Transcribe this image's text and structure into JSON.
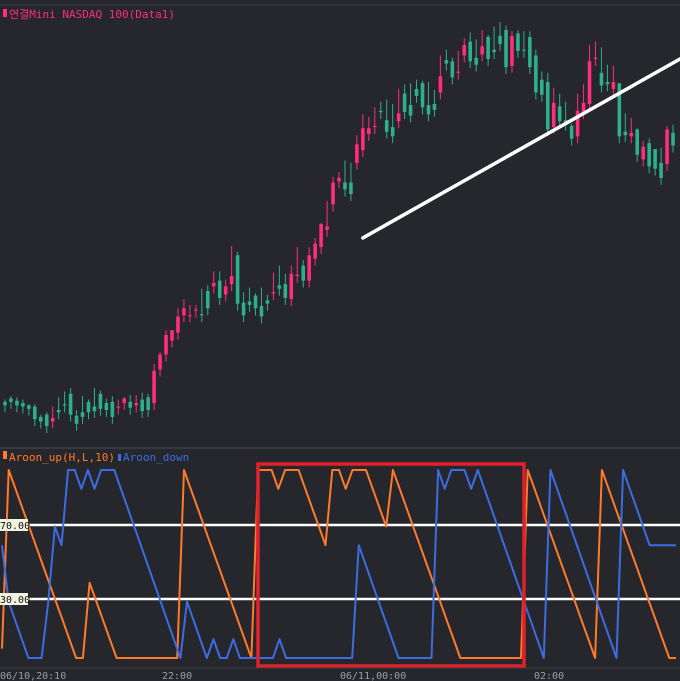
{
  "price_pane": {
    "title": "연결Mini NASDAQ 100(Data1)",
    "title_color": "#ff2d7a",
    "marker_color": "#ff2d7a"
  },
  "indicator_pane": {
    "up_label": "Aroon_up(H,L,10)",
    "down_label": "Aroon_down",
    "up_color": "#ff7a2a",
    "down_color": "#3d6be0",
    "level_high": "70.00",
    "level_low": "30.00"
  },
  "time_axis": {
    "labels": [
      "06/10,20:10",
      "22:00",
      "06/11,00:00",
      "02:00"
    ]
  },
  "colors": {
    "background": "#25272c",
    "up_candle": "#ff2d7a",
    "down_candle": "#2fb08a",
    "trendline": "#ffffff",
    "highlight_box": "#e0202a",
    "level_line": "#ffffff"
  },
  "chart_data": [
    {
      "type": "candlestick",
      "title": "연결Mini NASDAQ 100(Data1)",
      "ohlc": [
        [
          300,
          297,
          302,
          303
        ],
        [
          303,
          300,
          305,
          301
        ],
        [
          301,
          297,
          304,
          299
        ],
        [
          299,
          296,
          302,
          297
        ],
        [
          297,
          294,
          298,
          296
        ],
        [
          296,
          285,
          298,
          287
        ],
        [
          287,
          283,
          289,
          289
        ],
        [
          289,
          279,
          291,
          283
        ],
        [
          283,
          286,
          296,
          293
        ],
        [
          293,
          291,
          304,
          298
        ],
        [
          298,
          297,
          309,
          307
        ],
        [
          307,
          289,
          312,
          288
        ],
        [
          288,
          281,
          293,
          291
        ],
        [
          291,
          287,
          305,
          300
        ],
        [
          300,
          291,
          302,
          296
        ],
        [
          296,
          292,
          312,
          307
        ],
        [
          307,
          294,
          310,
          299
        ],
        [
          299,
          293,
          303,
          300
        ],
        [
          300,
          287,
          305,
          295
        ],
        [
          295,
          296,
          302,
          299
        ],
        [
          299,
          303,
          304,
          300
        ],
        [
          300,
          295,
          306,
          297
        ],
        [
          297,
          299,
          306,
          302
        ],
        [
          302,
          292,
          308,
          304
        ],
        [
          304,
          293,
          307,
          299
        ],
        [
          299,
          327,
          333,
          328
        ],
        [
          328,
          341,
          343,
          341
        ],
        [
          341,
          358,
          362,
          353
        ],
        [
          353,
          362,
          362,
          360
        ],
        [
          360,
          374,
          381,
          375
        ],
        [
          375,
          381,
          389,
          375
        ],
        [
          375,
          375,
          384,
          379
        ],
        [
          379,
          380,
          384,
          376
        ],
        [
          376,
          375,
          398,
          396
        ],
        [
          396,
          381,
          401,
          400
        ],
        [
          400,
          403,
          413,
          405
        ],
        [
          405,
          390,
          413,
          393
        ],
        [
          393,
          400,
          406,
          402
        ],
        [
          402,
          409,
          435,
          427
        ],
        [
          427,
          385,
          430,
          386
        ],
        [
          386,
          375,
          395,
          387
        ],
        [
          387,
          384,
          399,
          392
        ],
        [
          392,
          381,
          394,
          383
        ],
        [
          383,
          374,
          399,
          388
        ],
        [
          388,
          385,
          393,
          394
        ],
        [
          394,
          395,
          412,
          401
        ],
        [
          401,
          398,
          418,
          402
        ],
        [
          402,
          390,
          411,
          389
        ],
        [
          389,
          411,
          418,
          409
        ],
        [
          409,
          410,
          434,
          418
        ],
        [
          418,
          405,
          423,
          405
        ],
        [
          405,
          427,
          434,
          424
        ],
        [
          424,
          437,
          442,
          434
        ],
        [
          434,
          454,
          455,
          449
        ],
        [
          449,
          452,
          474,
          471
        ],
        [
          471,
          490,
          495,
          491
        ],
        [
          491,
          494,
          499,
          490
        ],
        [
          490,
          484,
          509,
          490
        ],
        [
          490,
          480,
          507,
          507
        ],
        [
          507,
          523,
          531,
          518
        ],
        [
          518,
          537,
          549,
          532
        ],
        [
          532,
          537,
          547,
          538
        ],
        [
          538,
          539,
          555,
          552
        ],
        [
          552,
          551,
          560,
          544
        ],
        [
          544,
          534,
          562,
          538
        ],
        [
          538,
          530,
          558,
          543
        ],
        [
          543,
          550,
          571,
          567
        ],
        [
          567,
          551,
          575,
          557
        ],
        [
          557,
          548,
          576,
          571
        ],
        [
          571,
          565,
          579,
          576
        ],
        [
          576,
          555,
          578,
          557
        ],
        [
          557,
          549,
          577,
          558
        ],
        [
          558,
          553,
          570,
          568
        ],
        [
          568,
          582,
          600,
          596
        ],
        [
          596,
          593,
          605,
          595
        ],
        [
          595,
          581,
          598,
          585
        ],
        [
          585,
          586,
          604,
          600
        ],
        [
          600,
          609,
          615,
          612
        ],
        [
          612,
          595,
          620,
          598
        ],
        [
          598,
          592,
          614,
          601
        ],
        [
          601,
          608,
          622,
          616
        ],
        [
          616,
          597,
          618,
          605
        ],
        [
          605,
          603,
          625,
          617
        ],
        [
          617,
          610,
          629,
          622
        ],
        [
          622,
          590,
          626,
          591
        ],
        [
          591,
          617,
          621,
          619
        ],
        [
          619,
          604,
          622,
          605
        ],
        [
          605,
          604,
          621,
          616
        ],
        [
          616,
          590,
          621,
          600
        ],
        [
          600,
          568,
          605,
          579
        ],
        [
          579,
          566,
          586,
          577
        ],
        [
          577,
          536,
          585,
          538
        ],
        [
          538,
          559,
          572,
          556
        ],
        [
          556,
          543,
          567,
          544
        ],
        [
          544,
          541,
          560,
          539
        ],
        [
          539,
          528,
          541,
          530
        ],
        [
          530,
          552,
          567,
          551
        ],
        [
          551,
          559,
          575,
          558
        ],
        [
          558,
          595,
          609,
          597
        ],
        [
          597,
          598,
          612,
          585
        ],
        [
          585,
          574,
          607,
          577
        ],
        [
          577,
          575,
          592,
          571
        ],
        [
          571,
          577,
          591,
          576
        ],
        [
          576,
          530,
          575,
          534
        ],
        [
          534,
          531,
          550,
          530
        ],
        [
          530,
          533,
          546,
          536
        ],
        [
          536,
          514,
          537,
          510
        ],
        [
          510,
          521,
          526,
          524
        ],
        [
          524,
          504,
          528,
          519
        ],
        [
          519,
          502,
          518,
          507
        ],
        [
          507,
          494,
          520,
          506
        ],
        [
          506,
          536,
          539,
          533
        ],
        [
          533,
          522,
          540,
          525
        ]
      ],
      "trendline": {
        "from": {
          "index": 60,
          "value": 442
        },
        "to": {
          "index": 118,
          "value": 611
        }
      }
    },
    {
      "type": "line",
      "title": "",
      "ylim": [
        0,
        100
      ],
      "levels": [
        70,
        30
      ],
      "series": [
        {
          "name": "Aroon_up(H,L,10)",
          "color": "#ff7a2a",
          "values": [
            5,
            100,
            90,
            80,
            70,
            60,
            50,
            40,
            30,
            20,
            10,
            0,
            0,
            40,
            30,
            20,
            10,
            0,
            0,
            0,
            0,
            0,
            0,
            0,
            0,
            0,
            0,
            100,
            90,
            80,
            70,
            60,
            50,
            40,
            30,
            20,
            10,
            0,
            100,
            100,
            100,
            90,
            100,
            100,
            100,
            90,
            80,
            70,
            60,
            100,
            100,
            90,
            100,
            100,
            100,
            90,
            80,
            70,
            100,
            90,
            80,
            70,
            60,
            50,
            40,
            30,
            20,
            10,
            0,
            0,
            0,
            0,
            0,
            0,
            0,
            0,
            0,
            0,
            100,
            90,
            80,
            70,
            60,
            50,
            40,
            30,
            20,
            10,
            0,
            100,
            90,
            80,
            70,
            60,
            50,
            40,
            30,
            20,
            10,
            0,
            0
          ]
        },
        {
          "name": "Aroon_down",
          "color": "#3d6be0",
          "values": [
            60,
            30,
            20,
            10,
            0,
            0,
            0,
            30,
            70,
            60,
            100,
            100,
            90,
            100,
            90,
            100,
            100,
            100,
            90,
            80,
            70,
            60,
            50,
            40,
            30,
            20,
            10,
            0,
            30,
            20,
            10,
            0,
            10,
            0,
            0,
            10,
            0,
            0,
            0,
            0,
            0,
            0,
            10,
            0,
            0,
            0,
            0,
            0,
            0,
            0,
            0,
            0,
            0,
            0,
            60,
            50,
            40,
            30,
            20,
            10,
            0,
            0,
            0,
            0,
            0,
            0,
            100,
            90,
            100,
            100,
            100,
            90,
            100,
            90,
            80,
            70,
            60,
            50,
            40,
            30,
            20,
            10,
            0,
            100,
            90,
            80,
            70,
            60,
            50,
            40,
            30,
            20,
            10,
            0,
            100,
            90,
            80,
            70,
            60,
            60,
            60,
            60,
            60
          ]
        }
      ]
    }
  ]
}
